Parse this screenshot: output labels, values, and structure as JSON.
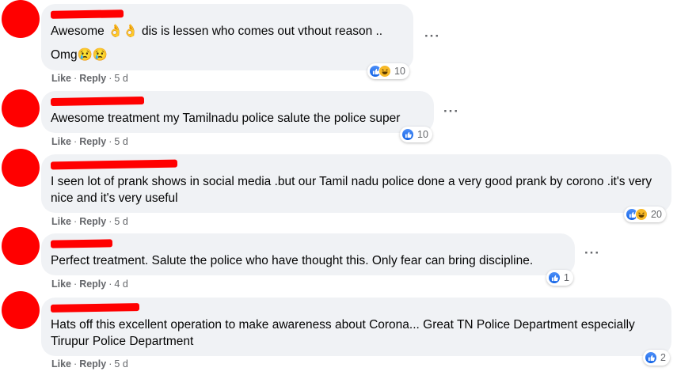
{
  "actions": {
    "like": "Like",
    "reply": "Reply",
    "dot": "·"
  },
  "more_label": "···",
  "colors": {
    "avatar_redaction": "#ff0000",
    "bubble": "#f0f2f5",
    "like": "#1877f2",
    "haha": "#f7b928"
  },
  "comments": [
    {
      "lines": [
        "Awesome 👌👌 dis is lessen who comes out vthout reason ..",
        "Omg😢😢"
      ],
      "time": "5 d",
      "reaction_count": "10",
      "reactions": [
        "like-icon",
        "haha-icon"
      ]
    },
    {
      "lines": [
        "Awesome treatment my Tamilnadu police salute the police super"
      ],
      "time": "5 d",
      "reaction_count": "10",
      "reactions": [
        "like-icon"
      ]
    },
    {
      "lines": [
        "I seen lot of prank shows in social media .but our Tamil nadu police done a very good prank by corono .it's very nice and it's very useful"
      ],
      "time": "5 d",
      "reaction_count": "20",
      "reactions": [
        "like-icon",
        "haha-icon"
      ]
    },
    {
      "lines": [
        "Perfect treatment. Salute the police who have thought this. Only fear can bring discipline."
      ],
      "time": "4 d",
      "reaction_count": "1",
      "reactions": [
        "like-icon"
      ]
    },
    {
      "lines": [
        "Hats off this excellent operation to make awareness about Corona... Great TN Police Department especially Tirupur Police Department"
      ],
      "time": "5 d",
      "reaction_count": "2",
      "reactions": [
        "like-icon"
      ]
    }
  ]
}
